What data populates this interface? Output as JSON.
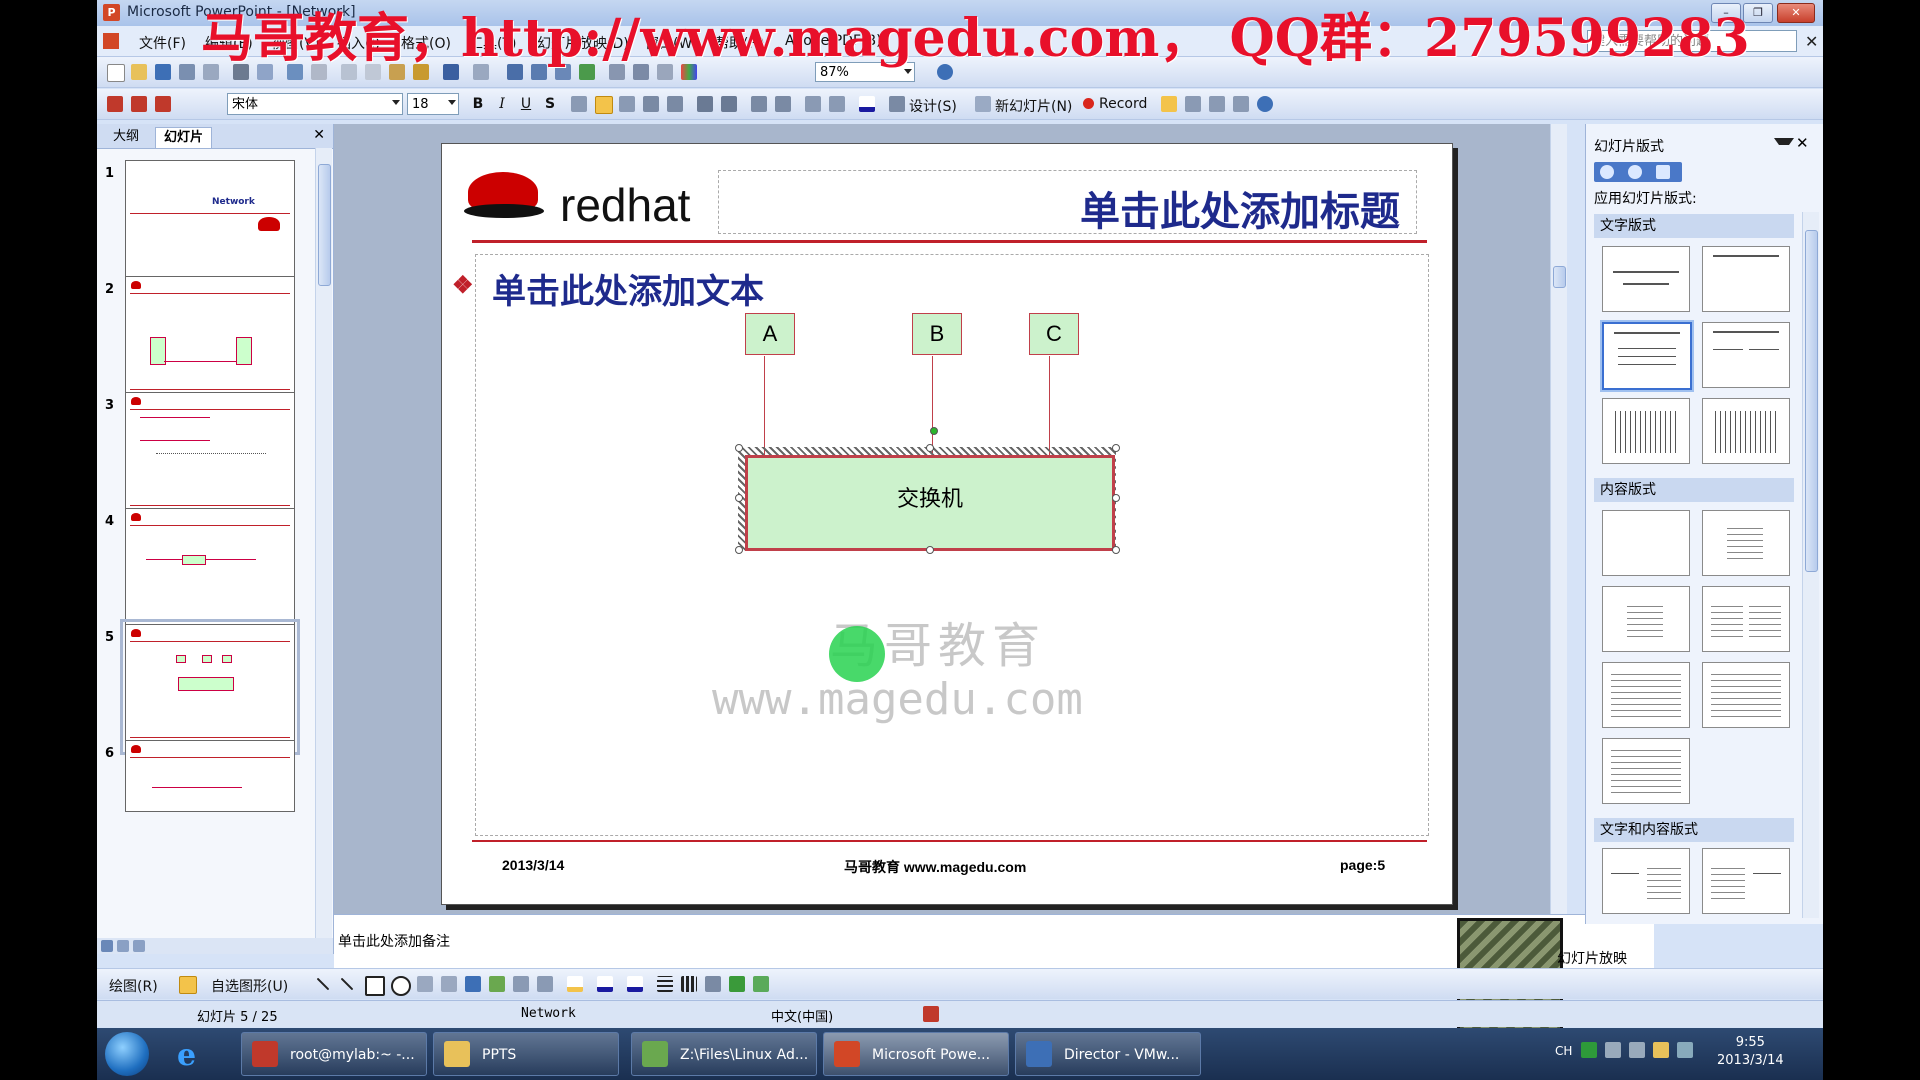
{
  "window": {
    "title": "Microsoft PowerPoint - [Network]",
    "banner": "马哥教育，http://www.magedu.com， QQ群：279599283",
    "controls": {
      "min": "–",
      "max": "❐",
      "close": "✕"
    }
  },
  "menu": {
    "items": [
      "文件(F)",
      "编辑(E)",
      "视图(V)",
      "插入(I)",
      "格式(O)",
      "工具(T)",
      "幻灯片放映(D)",
      "窗口(W)",
      "帮助(H)",
      "Adobe PDF(B)"
    ],
    "help_placeholder": "键入需要帮助的问题",
    "close": "✕"
  },
  "standard_toolbar": {
    "zoom": "87%"
  },
  "format_toolbar": {
    "font": "宋体",
    "size": "18",
    "bold": "B",
    "italic": "I",
    "underline": "U",
    "shadow": "S",
    "design": "设计(S)",
    "new_slide": "新幻灯片(N)",
    "record": "Record"
  },
  "left_pane": {
    "tabs": [
      "大纲",
      "幻灯片"
    ],
    "close": "✕",
    "thumbs": [
      {
        "num": "1",
        "label": "Network"
      },
      {
        "num": "2",
        "label": ""
      },
      {
        "num": "3",
        "label": ""
      },
      {
        "num": "4",
        "label": ""
      },
      {
        "num": "5",
        "label": ""
      },
      {
        "num": "6",
        "label": ""
      }
    ]
  },
  "slide": {
    "logo": "redhat",
    "title": "单击此处添加标题",
    "bullet": "单击此处添加文本",
    "nodes": [
      "A",
      "B",
      "C"
    ],
    "switch_label": "交换机",
    "watermark_cn": "马哥教育",
    "watermark_url": "www.magedu.com",
    "footer_date": "2013/3/14",
    "footer_center": "马哥教育 www.magedu.com",
    "footer_page_label": "page:",
    "footer_page_num": "5"
  },
  "notes": {
    "placeholder": "单击此处添加备注"
  },
  "task_pane": {
    "title": "幻灯片版式",
    "close": "✕",
    "apply_label": "应用幻灯片版式:",
    "sections": [
      "文字版式",
      "内容版式",
      "文字和内容版式"
    ],
    "footer": "幻灯片放映"
  },
  "drawing_toolbar": {
    "draw": "绘图(R)",
    "autoshapes": "自选图形(U)"
  },
  "status": {
    "slide": "幻灯片 5 / 25",
    "design": "Network",
    "lang": "中文(中国)"
  },
  "taskbar": {
    "buttons": [
      {
        "label": "root@mylab:~ -...",
        "color": "#c0392b"
      },
      {
        "label": "PPTS",
        "color": "#e8c15a"
      },
      {
        "label": "Z:\\Files\\Linux Ad...",
        "color": "#6aa84f"
      },
      {
        "label": "Microsoft Powe...",
        "color": "#d24726"
      },
      {
        "label": "Director - VMw...",
        "color": "#3d6fb6"
      }
    ],
    "ime": "CH",
    "time": "9:55",
    "date": "2013/3/14"
  },
  "colors": {
    "accent_red": "#c0202a",
    "title_blue": "#1e2a8c",
    "node_fill": "#ccf2cc"
  }
}
